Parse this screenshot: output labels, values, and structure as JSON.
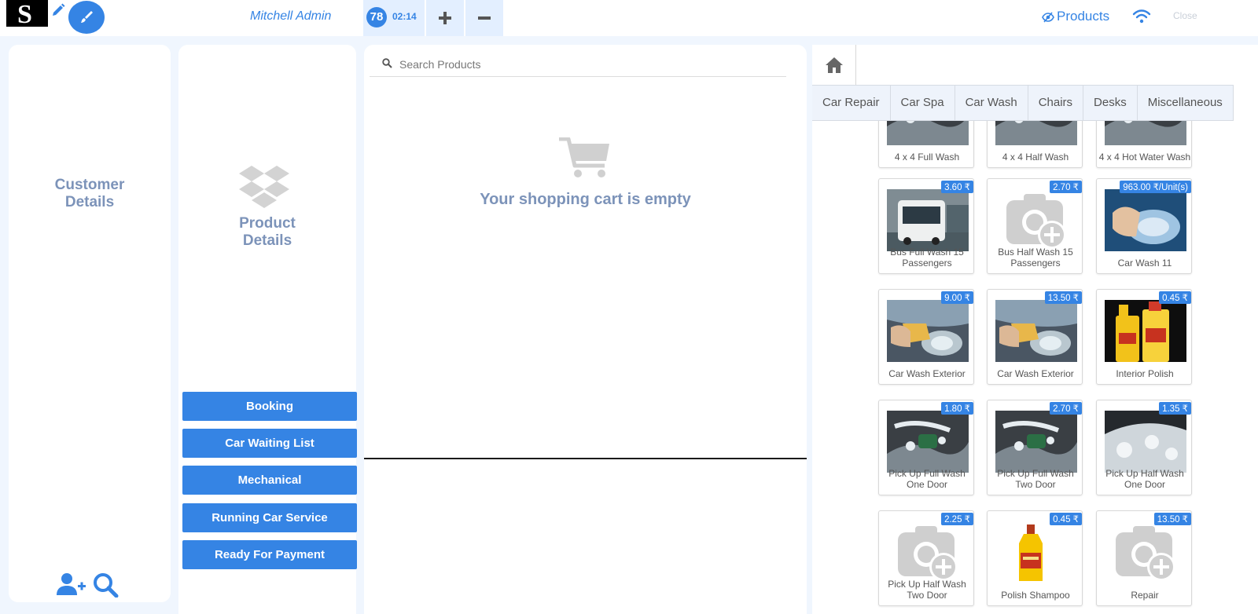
{
  "topbar": {
    "cashier": "Mitchell Admin",
    "order_number": "78",
    "order_time": "02:14",
    "products_label": "Products",
    "close_label": "Close",
    "logo_letter": "S"
  },
  "customer_panel": {
    "title_line1": "Customer",
    "title_line2": "Details"
  },
  "product_panel": {
    "title_line1": "Product",
    "title_line2": "Details",
    "buttons": [
      "Booking",
      "Car Waiting List",
      "Mechanical",
      "Running Car Service",
      "Ready For Payment"
    ]
  },
  "cart": {
    "search_placeholder": "Search Products",
    "empty_message": "Your shopping cart is empty"
  },
  "categories": [
    "Car Repair",
    "Car Spa",
    "Car Wash",
    "Chairs",
    "Desks",
    "Miscellaneous"
  ],
  "products": [
    {
      "name": "4 x 4 Full Wash",
      "price": "",
      "image": "wash-photo"
    },
    {
      "name": "4 x 4 Half Wash",
      "price": "",
      "image": "wash-photo"
    },
    {
      "name": "4 x 4 Hot Water Wash",
      "price": "",
      "image": "wash-photo"
    },
    {
      "name": "Bus Full Wash 15 Passengers",
      "price": "3.60 ₹",
      "image": "bus-photo"
    },
    {
      "name": "Bus Half Wash 15 Passengers",
      "price": "2.70 ₹",
      "image": "camera-placeholder"
    },
    {
      "name": "Car Wash 11",
      "price": "963.00 ₹/Unit(s)",
      "image": "headlight-photo"
    },
    {
      "name": "Car Wash Exterior",
      "price": "9.00 ₹",
      "image": "sponge-photo"
    },
    {
      "name": "Car Wash Exterior",
      "price": "13.50 ₹",
      "image": "sponge-photo"
    },
    {
      "name": "Interior Polish",
      "price": "0.45 ₹",
      "image": "polish-bottles"
    },
    {
      "name": "Pick Up Full Wash One Door",
      "price": "1.80 ₹",
      "image": "wash-photo"
    },
    {
      "name": "Pick Up Full Wash Two Door",
      "price": "2.70 ₹",
      "image": "wash-photo"
    },
    {
      "name": "Pick Up Half Wash One Door",
      "price": "1.35 ₹",
      "image": "foam-photo"
    },
    {
      "name": "Pick Up Half Wash Two Door",
      "price": "2.25 ₹",
      "image": "camera-placeholder"
    },
    {
      "name": "Polish Shampoo",
      "price": "0.45 ₹",
      "image": "shampoo-bottle"
    },
    {
      "name": "Repair",
      "price": "13.50 ₹",
      "image": "camera-placeholder"
    }
  ],
  "colors": {
    "accent": "#3584e4",
    "muted_title": "#7c93b9",
    "background": "#f0f6fe"
  }
}
